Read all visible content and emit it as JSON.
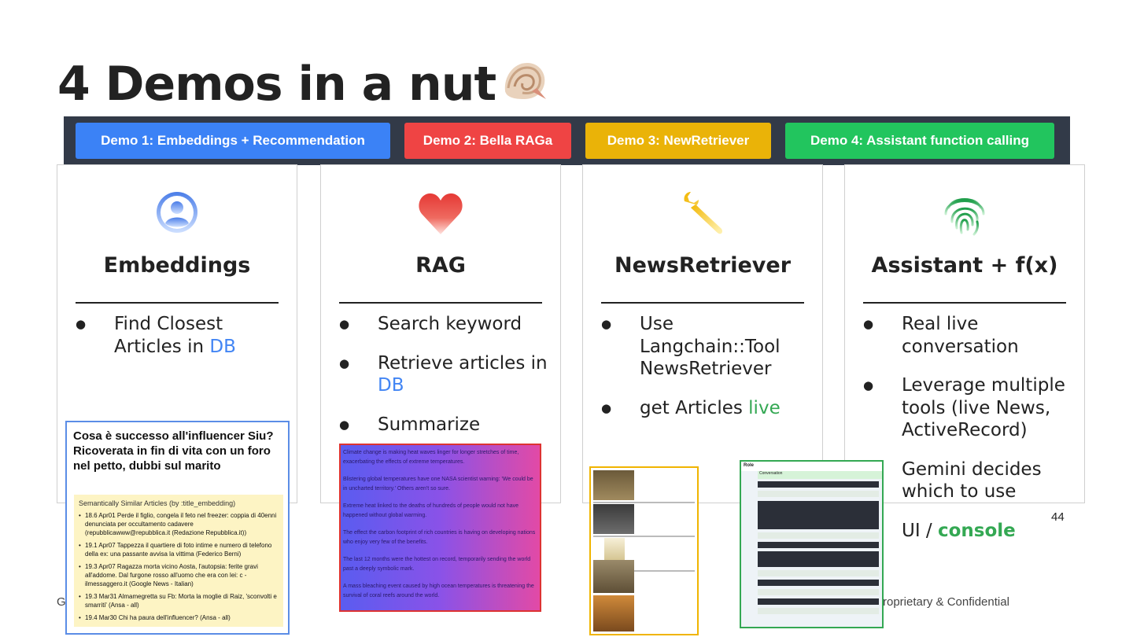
{
  "slide": {
    "title": "4 Demos in a nut",
    "title_icon": "spiral-shell-icon",
    "page_number": "44",
    "footer_left": "G",
    "footer_right": "roprietary & Confidential"
  },
  "tabs": [
    {
      "label": "Demo 1: Embeddings + Recommendation",
      "color": "#3b82f6"
    },
    {
      "label": "Demo 2: Bella RAGa",
      "color": "#ef4444"
    },
    {
      "label": "Demo 3: NewRetriever",
      "color": "#eab308"
    },
    {
      "label": "Demo 4: Assistant function calling",
      "color": "#22c55e"
    }
  ],
  "cards": [
    {
      "icon": "user-avatar-icon",
      "heading": "Embeddings",
      "bullets": [
        {
          "text": "Find Closest Articles in ",
          "highlight": "DB"
        }
      ]
    },
    {
      "icon": "heart-icon",
      "heading": "RAG",
      "bullets": [
        {
          "text": "Search keyword"
        },
        {
          "text": "Retrieve articles in ",
          "highlight": "DB"
        },
        {
          "text": "Summarize"
        }
      ]
    },
    {
      "icon": "wrench-icon",
      "heading": "NewsRetriever",
      "bullets": [
        {
          "text": "Use Langchain::Tool NewsRetriever"
        },
        {
          "text": "get Articles ",
          "highlight": "live"
        }
      ]
    },
    {
      "icon": "fingerprint-icon",
      "heading": "Assistant + f(x)",
      "bullets": [
        {
          "text": "Real live conversation"
        },
        {
          "text": "Leverage multiple tools (live News, ActiveRecord)"
        },
        {
          "text": "Gemini decides which to use"
        },
        {
          "text": "UI / ",
          "highlight": "console"
        }
      ]
    }
  ],
  "screenshot_embeddings": {
    "headline": "Cosa è successo all'influencer Siu? Ricoverata in fin di vita con un foro nel petto, dubbi sul marito",
    "similar_title": "Semantically Similar Articles (by :title_embedding)",
    "items": [
      "18.6 Apr01 Perde il figlio, congela il feto nel freezer: coppia di 40enni denunciata per occultamento cadavere (repubblicawww@repubblica.it (Redazione Repubblica.it))",
      "19.1 Apr07 Tappezza il quartiere di foto intime e numero di telefono della ex: una passante avvisa la vittima (Federico Berni)",
      "19.3 Apr07 Ragazza morta vicino Aosta, l'autopsia: ferite gravi all'addome. Dal furgone rosso all'uomo che era con lei: c - ilmessaggero.it (Google News - Italian)",
      "19.3 Mar31 Almamegretta su Fb: Morta la moglie di Raiz, 'sconvolti e smarriti' (Ansa - all)",
      "19.4 Mar30 Chi ha paura dell'influencer? (Ansa - all)"
    ]
  },
  "screenshot_rag": {
    "paragraphs": [
      "Climate change is making heat waves linger for longer stretches of time, exacerbating the effects of extreme temperatures.",
      "Blistering global temperatures have one NASA scientist warning: 'We could be in uncharted territory.' Others aren't so sure.",
      "Extreme heat linked to the deaths of hundreds of people would not have happened without global warming.",
      "The effect the carbon footprint of rich countries is having on developing nations who enjoy very few of the benefits.",
      "The last 12 months were the hottest on record, temporarily sending the world past a deeply symbolic mark.",
      "A mass bleaching event caused by high ocean temperatures is threatening the survival of coral reefs around the world."
    ]
  },
  "screenshot_assistant": {
    "window_title": "Role",
    "column_header": "Conversation"
  }
}
